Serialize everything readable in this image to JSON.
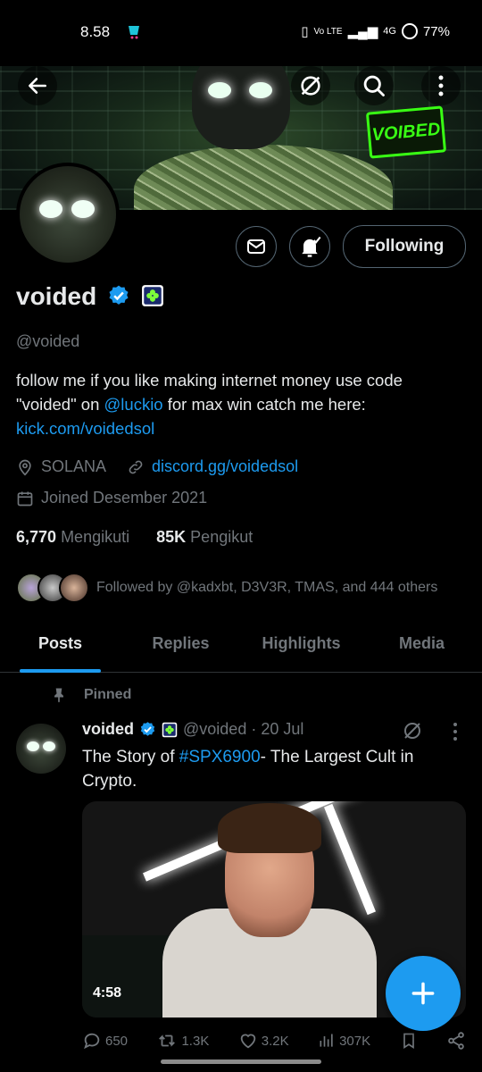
{
  "status_bar": {
    "time": "8.58",
    "network": "Vo LTE",
    "signal": "4G",
    "battery": "77%"
  },
  "banner": {
    "badge_text": "VOIBED"
  },
  "header": {
    "back_icon": "arrow-left-icon",
    "grok_icon": "slash-circle-icon",
    "search_icon": "search-icon",
    "more_icon": "vertical-dots-icon"
  },
  "profile": {
    "following_label": "Following",
    "name": "voided",
    "handle": "@voided",
    "bio_part1": "follow me if you like making internet money  use code \"voided\" on ",
    "bio_mention": "@luckio",
    "bio_part2": " for max win  catch me here: ",
    "bio_link": "kick.com/voidedsol",
    "location": "SOLANA",
    "website": "discord.gg/voidedsol",
    "joined": "Joined Desember 2021",
    "following_count": "6,770",
    "following_text": "Mengikuti",
    "followers_count": "85K",
    "followers_text": "Pengikut",
    "followed_by": "Followed by @kadxbt, D3V3R, TMAS, and 444 others"
  },
  "tabs": [
    "Posts",
    "Replies",
    "Highlights",
    "Media"
  ],
  "post": {
    "pinned_label": "Pinned",
    "author": "voided",
    "handle_date": "@voided · 20 Jul",
    "text_part1": "The Story of ",
    "hashtag": "#SPX6900",
    "text_part2": "- The Largest Cult in Crypto.",
    "duration": "4:58",
    "replies": "650",
    "reposts": "1.3K",
    "likes": "3.2K",
    "views": "307K"
  },
  "colors": {
    "accent": "#1d9bf0",
    "background": "#000000",
    "muted": "#71767b",
    "badge_green": "#39ff14"
  }
}
